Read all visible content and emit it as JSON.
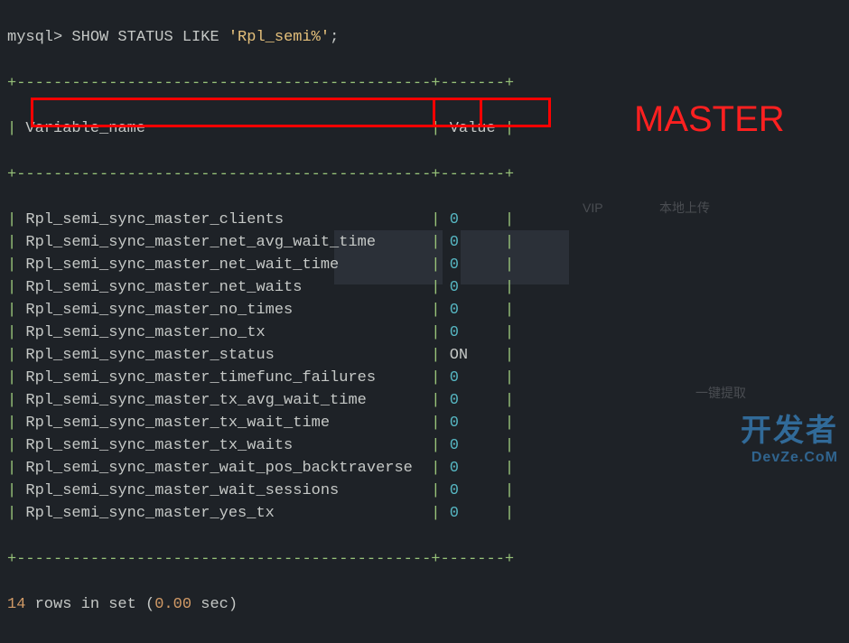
{
  "prompt": "mysql> ",
  "command": {
    "keyword": "SHOW STATUS LIKE ",
    "string": "'Rpl_semi%'",
    "terminator": ";"
  },
  "headers": {
    "col1": "Variable_name",
    "col2": "Value"
  },
  "rows": [
    {
      "name": "Rpl_semi_sync_master_clients",
      "value": "0"
    },
    {
      "name": "Rpl_semi_sync_master_net_avg_wait_time",
      "value": "0"
    },
    {
      "name": "Rpl_semi_sync_master_net_wait_time",
      "value": "0"
    },
    {
      "name": "Rpl_semi_sync_master_net_waits",
      "value": "0"
    },
    {
      "name": "Rpl_semi_sync_master_no_times",
      "value": "0"
    },
    {
      "name": "Rpl_semi_sync_master_no_tx",
      "value": "0"
    },
    {
      "name": "Rpl_semi_sync_master_status",
      "value": "ON"
    },
    {
      "name": "Rpl_semi_sync_master_timefunc_failures",
      "value": "0"
    },
    {
      "name": "Rpl_semi_sync_master_tx_avg_wait_time",
      "value": "0"
    },
    {
      "name": "Rpl_semi_sync_master_tx_wait_time",
      "value": "0"
    },
    {
      "name": "Rpl_semi_sync_master_tx_waits",
      "value": "0"
    },
    {
      "name": "Rpl_semi_sync_master_wait_pos_backtraverse",
      "value": "0"
    },
    {
      "name": "Rpl_semi_sync_master_wait_sessions",
      "value": "0"
    },
    {
      "name": "Rpl_semi_sync_master_yes_tx",
      "value": "0"
    }
  ],
  "summary": {
    "count": "14",
    "text1": " rows in set (",
    "time": "0.00",
    "text2": " sec)"
  },
  "annotation": "MASTER",
  "watermark": {
    "line1": "开发者",
    "line2": "DevZe.CoM"
  },
  "border": {
    "top": "+---------------------------------------------+-------+",
    "mid": "+---------------------------------------------+-------+",
    "bot": "+---------------------------------------------+-------+"
  },
  "bg_hints": {
    "vip": "VIP",
    "upload": "本地上传",
    "extract": "一键提取"
  }
}
